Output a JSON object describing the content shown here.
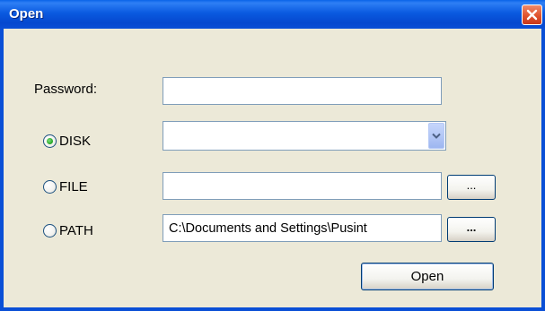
{
  "window": {
    "title": "Open"
  },
  "form": {
    "password_label": "Password:",
    "password_value": "",
    "disk_label": "DISK",
    "disk_selected": true,
    "disk_value": "",
    "file_label": "FILE",
    "file_selected": false,
    "file_value": "",
    "file_browse_label": "...",
    "path_label": "PATH",
    "path_selected": false,
    "path_value": "C:\\Documents and Settings\\Pusint",
    "path_browse_label": "..."
  },
  "actions": {
    "open_label": "Open"
  },
  "colors": {
    "titlebar": "#0a4fd6",
    "body": "#ece9d8",
    "close": "#e0532e"
  }
}
